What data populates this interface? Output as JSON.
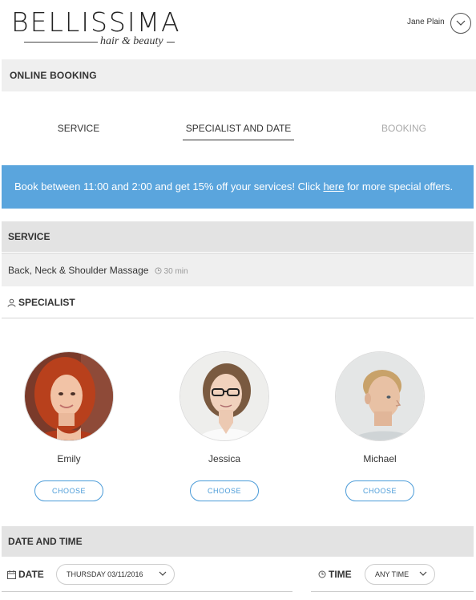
{
  "brand": {
    "name": "BELLISSIMA",
    "tagline": "hair & beauty"
  },
  "user": {
    "name": "Jane Plain",
    "menu_icon": "chevron-down-icon"
  },
  "page": {
    "header": "ONLINE BOOKING"
  },
  "steps": [
    {
      "label": "SERVICE",
      "state": "done"
    },
    {
      "label": "SPECIALIST AND DATE",
      "state": "active"
    },
    {
      "label": "BOOKING",
      "state": "disabled"
    }
  ],
  "promo": {
    "text_before": "Book between 11:00 and 2:00 and get 15% off your services! Click ",
    "link": "here",
    "text_after": " for more special offers."
  },
  "service": {
    "title": "SERVICE",
    "name": "Back, Neck & Shoulder Massage",
    "duration": "30 min"
  },
  "specialist": {
    "title": "SPECIALIST",
    "choose_label": "CHOOSE",
    "people": [
      {
        "name": "Emily"
      },
      {
        "name": "Jessica"
      },
      {
        "name": "Michael"
      }
    ]
  },
  "datetime": {
    "title": "DATE AND TIME",
    "date_label": "DATE",
    "date_value": "THURSDAY 03/11/2016",
    "time_label": "TIME",
    "time_value": "ANY TIME"
  },
  "colors": {
    "accent": "#5aa5dd",
    "button": "#4a9bd8",
    "header_bg": "#efefef"
  }
}
